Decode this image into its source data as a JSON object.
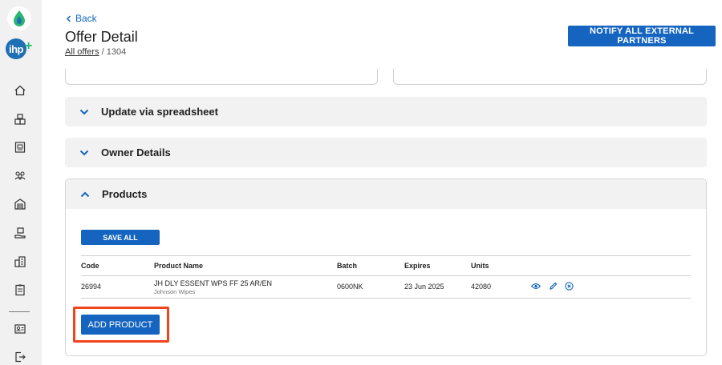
{
  "header": {
    "back_label": "Back",
    "title": "Offer Detail",
    "breadcrumb_link": "All offers",
    "breadcrumb_separator": "/",
    "breadcrumb_current": "1304",
    "notify_button": "NOTIFY ALL EXTERNAL PARTNERS"
  },
  "sidebar": {
    "logo_text": "ihp",
    "logo_plus": "+",
    "items": [
      {
        "icon": "home-icon"
      },
      {
        "icon": "inventory-boxes-icon"
      },
      {
        "icon": "document-box-icon"
      },
      {
        "icon": "people-group-icon"
      },
      {
        "icon": "warehouse-icon"
      },
      {
        "icon": "hand-box-icon"
      },
      {
        "icon": "buildings-icon"
      },
      {
        "icon": "clipboard-icon"
      },
      {
        "icon": "id-card-icon"
      },
      {
        "icon": "logout-icon"
      }
    ]
  },
  "sections": {
    "spreadsheet": "Update via spreadsheet",
    "owner": "Owner Details",
    "products": "Products"
  },
  "products": {
    "save_all": "SAVE ALL",
    "columns": {
      "code": "Code",
      "product_name": "Product Name",
      "batch": "Batch",
      "expires": "Expires",
      "units": "Units"
    },
    "rows": [
      {
        "code": "26994",
        "product_name": "JH DLY ESSENT WPS FF 25 AR/EN",
        "brand": "Johnson Wipes",
        "batch": "0600NK",
        "expires": "23 Jun 2025",
        "units": "42080"
      }
    ],
    "row_actions": [
      "view-icon",
      "edit-icon",
      "remove-icon"
    ],
    "add_product": "ADD PRODUCT"
  },
  "colors": {
    "primary": "#1565c0",
    "highlight": "#f0441c",
    "sidebar_bg": "#f1f1f1",
    "accordion_bg": "#f2f2f2",
    "logo_green": "#2bb673"
  }
}
